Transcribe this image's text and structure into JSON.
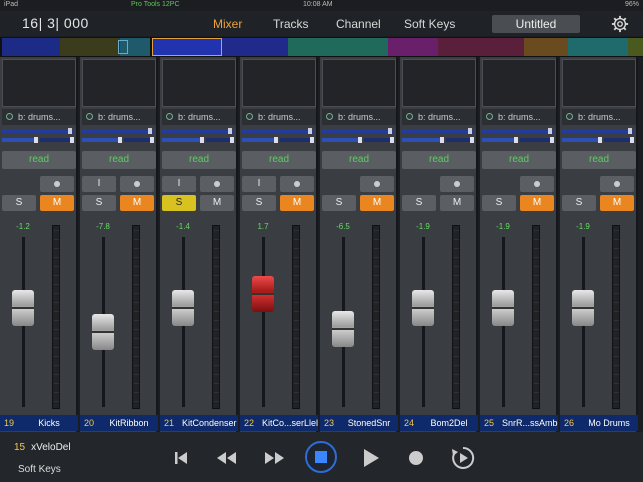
{
  "status": {
    "carrier": "iPad",
    "app": "Pro Tools 12PC",
    "clock": "10:08 AM",
    "battery": "96%"
  },
  "counter": "16| 3| 000",
  "nav": {
    "tabs": [
      "Mixer",
      "Tracks",
      "Channel",
      "Soft Keys"
    ],
    "active": "Mixer"
  },
  "session_title": "Untitled",
  "strips": [
    {
      "num": "19",
      "name": "Kicks",
      "send": "b: drums...",
      "auto": "read",
      "vol": "-1.2",
      "solo": false,
      "mute": true,
      "has_input": false,
      "fader": 0.62,
      "red": false
    },
    {
      "num": "20",
      "name": "KitRibbon",
      "send": "b: drums...",
      "auto": "read",
      "vol": "-7.8",
      "solo": false,
      "mute": true,
      "has_input": true,
      "fader": 0.45,
      "red": false
    },
    {
      "num": "21",
      "name": "KitCondenser",
      "send": "b: drums...",
      "auto": "read",
      "vol": "-1.4",
      "solo": true,
      "mute": false,
      "has_input": true,
      "fader": 0.62,
      "red": false
    },
    {
      "num": "22",
      "name": "KitCo...serLlel",
      "send": "b: drums...",
      "auto": "read",
      "vol": "1.7",
      "solo": false,
      "mute": true,
      "has_input": true,
      "fader": 0.72,
      "red": true
    },
    {
      "num": "23",
      "name": "StonedSnr",
      "send": "b: drums...",
      "auto": "read",
      "vol": "-6.5",
      "solo": false,
      "mute": true,
      "has_input": false,
      "fader": 0.47,
      "red": false
    },
    {
      "num": "24",
      "name": "Bom2Del",
      "send": "b: drums...",
      "auto": "read",
      "vol": "-1.9",
      "solo": false,
      "mute": false,
      "has_input": false,
      "fader": 0.62,
      "red": false
    },
    {
      "num": "25",
      "name": "SnrR...ssAmb",
      "send": "b: drums...",
      "auto": "read",
      "vol": "-1.9",
      "solo": false,
      "mute": true,
      "has_input": false,
      "fader": 0.62,
      "red": false
    },
    {
      "num": "26",
      "name": "Mo Drums",
      "send": "b: drums...",
      "auto": "read",
      "vol": "-1.9",
      "solo": false,
      "mute": true,
      "has_input": false,
      "fader": 0.62,
      "red": false
    }
  ],
  "labels": {
    "solo": "S",
    "mute": "M",
    "input": "I"
  },
  "selected_track": {
    "num": "15",
    "name": "xVeloDel"
  },
  "softkeys_label": "Soft Keys",
  "icons": {
    "gear": "gear-icon",
    "transport": [
      "go-to-start-icon",
      "rewind-icon",
      "fast-forward-icon",
      "stop-icon",
      "play-icon",
      "record-icon",
      "loop-play-icon"
    ]
  },
  "colors": {
    "accent": "#f0a23c",
    "mute_on": "#e9861f",
    "solo_on": "#d8c21f",
    "automation_text": "#5ad15a",
    "name_plate": "#0f2a6a"
  }
}
